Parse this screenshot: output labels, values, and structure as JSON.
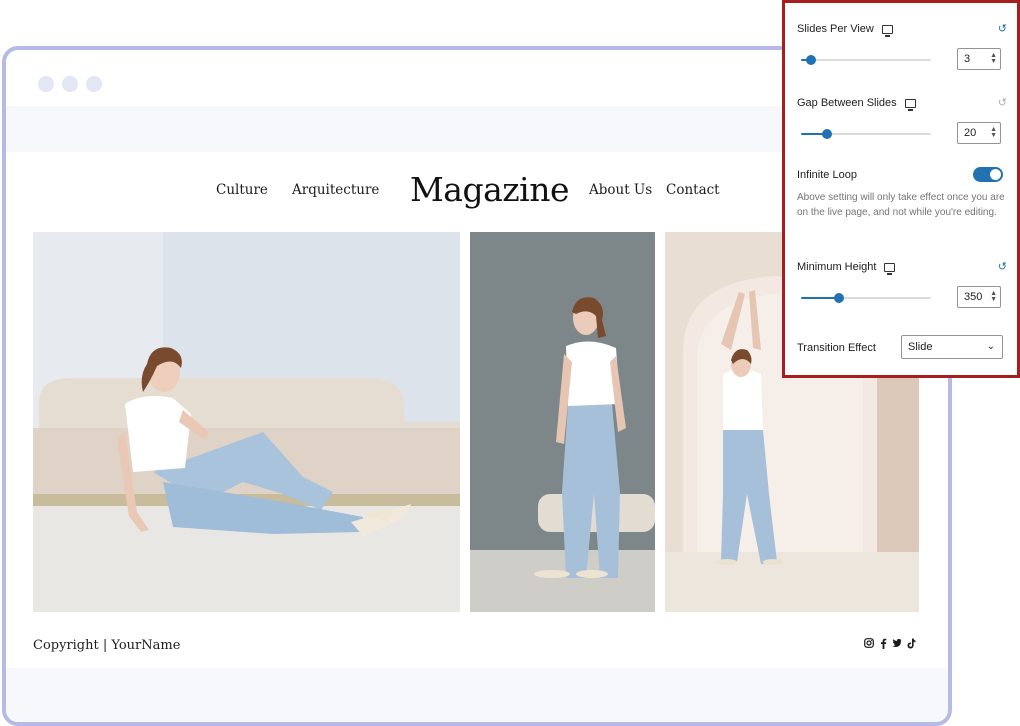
{
  "site": {
    "nav_left": [
      "Culture",
      "Arquitecture"
    ],
    "logo": "Magazine",
    "nav_right": [
      "About Us",
      "Contact"
    ],
    "copyright": "Copyright | YourName",
    "social_icons": [
      "instagram-icon",
      "facebook-icon",
      "twitter-icon",
      "tiktok-icon"
    ]
  },
  "panel": {
    "slides_per_view": {
      "label": "Slides Per View",
      "value": "3",
      "slider_fraction": 0.08
    },
    "gap_between_slides": {
      "label": "Gap Between Slides",
      "value": "20",
      "slider_fraction": 0.2
    },
    "infinite_loop": {
      "label": "Infinite Loop",
      "enabled": true,
      "help": "Above setting will only take effect once you are on the live page, and not while you're editing."
    },
    "minimum_height": {
      "label": "Minimum Height",
      "value": "350",
      "slider_fraction": 0.29
    },
    "transition_effect": {
      "label": "Transition Effect",
      "selected": "Slide"
    }
  },
  "colors": {
    "accent": "#2271b1",
    "panel_border": "#a81d1d",
    "frame": "#b5bbe6"
  }
}
